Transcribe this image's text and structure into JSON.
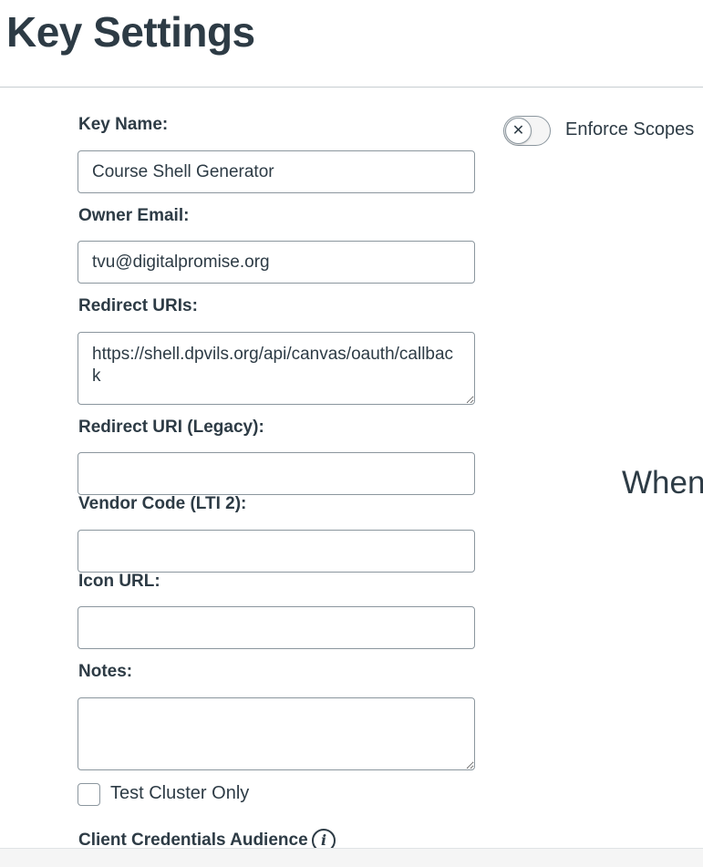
{
  "page": {
    "title": "Key Settings"
  },
  "form": {
    "key_name": {
      "label": "Key Name:",
      "value": "Course Shell Generator"
    },
    "owner_email": {
      "label": "Owner Email:",
      "value": "tvu@digitalpromise.org"
    },
    "redirect_uris": {
      "label": "Redirect URIs:",
      "value": "https://shell.dpvils.org/api/canvas/oauth/callback"
    },
    "redirect_uri_legacy": {
      "label": "Redirect URI (Legacy):",
      "value": ""
    },
    "vendor_code": {
      "label": "Vendor Code (LTI 2):",
      "value": ""
    },
    "icon_url": {
      "label": "Icon URL:",
      "value": ""
    },
    "notes": {
      "label": "Notes:",
      "value": ""
    },
    "test_cluster_only": {
      "label": "Test Cluster Only",
      "checked": false
    },
    "client_credentials_audience": {
      "label": "Client Credentials Audience",
      "icon": "info-icon"
    }
  },
  "scopes": {
    "toggle_label": "Enforce Scopes",
    "enabled": false,
    "toggle_icon": "close-icon",
    "toggle_glyph": "✕",
    "partial_text": "When"
  }
}
